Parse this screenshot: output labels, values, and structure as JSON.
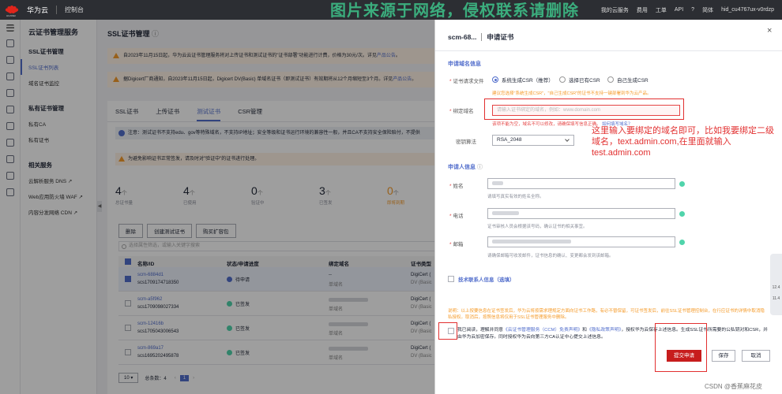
{
  "topbar": {
    "logo_text": "HUAWEI",
    "brand": "华为云",
    "console": "控制台",
    "links": [
      "我的云服务",
      "费用",
      "工单",
      "API"
    ],
    "lang": "简体",
    "user": "hid_cu4767ux-v0rdzp"
  },
  "watermark": "图片来源于网络，侵权联系请删除",
  "sidenav": {
    "title": "云证书管理服务",
    "groups": [
      {
        "label": "SSL证书管理",
        "items": [
          {
            "label": "SSL证书列表",
            "active": true
          },
          {
            "label": "域名证书监控",
            "active": false
          }
        ]
      },
      {
        "label": "私有证书管理",
        "items": [
          {
            "label": "私有CA",
            "active": false
          },
          {
            "label": "私有证书",
            "active": false
          }
        ]
      },
      {
        "label": "相关服务",
        "items": [
          {
            "label": "云解析服务 DNS ↗",
            "active": false
          },
          {
            "label": "Web应用防火墙 WAF ↗",
            "active": false
          },
          {
            "label": "内容分发网络 CDN ↗",
            "active": false
          }
        ]
      }
    ]
  },
  "main": {
    "title": "SSL证书管理",
    "notice1": "自2023年11月15日起，华为云云证书管理服务将对上传证书和测试证书的\"证书部署\"功能进行计费，价格为30元/次。详见",
    "notice1_link": "产品公告",
    "notice2": "据Digicert厂商通知，自2023年11月15日起，Digicert DV(Basic) 单域名证书（即测试证书）有效期将从12个月缩短至3个月。详见",
    "notice2_link": "产品公告",
    "tabs": [
      "SSL证书",
      "上传证书",
      "测试证书",
      "CSR管理"
    ],
    "active_tab": "测试证书",
    "info": "注意：测试证书不支持edu、gov等特殊域名，不支持IP地址；安全等级和证书运行环境的兼容性一般，并且CA不支持安全保险赔付，不提供",
    "warn": "为避免影响证书正常签发，请及时对\"验证中\"的证书进行处理。",
    "stats": [
      {
        "value": "4",
        "label": "总证书量"
      },
      {
        "value": "4",
        "label": "已使用"
      },
      {
        "value": "0",
        "label": "验证中"
      },
      {
        "value": "3",
        "label": "已签发"
      },
      {
        "value": "0",
        "label": "即将到期"
      }
    ],
    "buttons": [
      "删除",
      "创建测试证书",
      "购买扩容包"
    ],
    "search_placeholder": "选择属性筛选，或输入关键字搜索",
    "columns": [
      "名称/ID",
      "状态/申请进度",
      "绑定域名",
      "证书类型"
    ],
    "rows": [
      {
        "name": "scm-6884d1",
        "id": "scs1709174718350",
        "status": "待申请",
        "status_color": "#526ecc",
        "domain": "--",
        "domain_type": "单域名",
        "type": "DigiCert (",
        "type2": "DV (Basic",
        "selected": true
      },
      {
        "name": "scm-a5f962",
        "id": "scs1709098027334",
        "status": "已签发",
        "status_color": "#50d4ab",
        "domain": "",
        "domain_type": "单域名",
        "type": "DigiCert (",
        "type2": "DV (Basic",
        "selected": false
      },
      {
        "name": "scm-12416b",
        "id": "scs1705043006543",
        "status": "已签发",
        "status_color": "#50d4ab",
        "domain": "",
        "domain_type": "单域名",
        "type": "DigiCert (",
        "type2": "DV (Basic",
        "selected": false
      },
      {
        "name": "scm-869a17",
        "id": "scs1695202495878",
        "status": "已签发",
        "status_color": "#50d4ab",
        "domain": "",
        "domain_type": "单域名",
        "type": "DigiCert (",
        "type2": "DV (Basic",
        "selected": false
      }
    ],
    "pager": {
      "size": "10",
      "total": "总条数：4",
      "page": "1"
    }
  },
  "drawer": {
    "cert_name": "scm-68...",
    "title": "申请证书",
    "domain_section": "申请域名信息",
    "csr_label": "证书请求文件",
    "csr_options": [
      "系统生成CSR（推荐）",
      "选择已有CSR",
      "自己生成CSR"
    ],
    "csr_hint": "建议您选择\"系统生成CSR\"，\"自己生成CSR\"的证书不支持一键部署到华为云产品。",
    "domain_label": "绑定域名",
    "domain_placeholder": "请输入证书绑定的域名，例如：www.domain.com",
    "domain_error": "该项不能为空，域名不可以修改，请确保填写信息正确。",
    "domain_error_link": "如何填写域名？",
    "algo_label": "密钥算法",
    "algo_value": "RSA_2048",
    "applicant_section": "申请人信息",
    "name_label": "姓名",
    "name_hint": "请填写真实有效的姓名全称。",
    "phone_label": "电话",
    "phone_hint": "证书审核人员会根据该号码，确认证书的相关事宜。",
    "email_label": "邮箱",
    "email_hint": "请确保邮箱可收发邮件，证书信息的确认、变更都会发到该邮箱。",
    "tech_contact": "技术联系人信息（选填）",
    "legal_text": "说明：以上按要信息在证书签发后，华为云将按需求理规定方面向证书工作路，有必不替保留，可证书签发后，前往SSL证书管理控制台，在行应证书的详情中取消隐私授权。取消后，按照信息将仅用于SSL证书管理服务中删除。",
    "agree_pre": "我已阅读，理解并同意",
    "agree_link1": "《云证书管理服务（CCM）免责声明》",
    "agree_mid": "和",
    "agree_link2": "《隐私政策声明》",
    "agree_post": "，授权华为云保存上述信息。生成SSL证书所需要的公私钥对和CSR，并由华为云加密保存。同时授权华为云向第三方CA认证中心提交上述信息。",
    "submit": "提交申请",
    "save": "保存",
    "cancel": "取消",
    "sidetool": [
      "12.4",
      "11.4"
    ]
  },
  "annotation": "这里输入要绑定的域名即可，比如我要绑定二级域名，text.admin.com,在里面就输入test.admin.com",
  "credit": "CSDN @香蕉麻花皮"
}
